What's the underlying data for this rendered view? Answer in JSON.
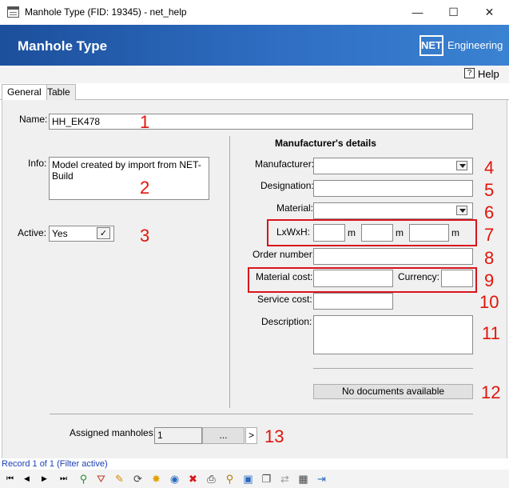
{
  "window": {
    "title": "Manhole Type (FID: 19345) - net_help",
    "minimize": "—",
    "maximize": "☐",
    "close": "✕"
  },
  "banner": {
    "title": "Manhole Type",
    "logo_box": "NET",
    "logo_text": "Engineering"
  },
  "help": {
    "label": "Help",
    "icon_glyph": "?"
  },
  "tabs": [
    {
      "label": "General"
    },
    {
      "label": "Table"
    }
  ],
  "form": {
    "name_label": "Name:",
    "name_value": "HH_EK478",
    "info_label": "Info:",
    "info_value": "Model created by import from NET-Build",
    "active_label": "Active:",
    "active_value": "Yes",
    "active_check": "✓",
    "manufacturer_section": "Manufacturer's details",
    "manufacturer_label": "Manufacturer:",
    "manufacturer_value": "",
    "designation_label": "Designation:",
    "designation_value": "",
    "material_label": "Material:",
    "material_value": "",
    "dims_label": "LxWxH:",
    "dims_unit": "m",
    "dims_l": "",
    "dims_w": "",
    "dims_h": "",
    "order_label": "Order number:",
    "order_value": "",
    "material_cost_label": "Material cost:",
    "material_cost_value": "",
    "currency_label": "Currency:",
    "currency_value": "",
    "service_cost_label": "Service cost:",
    "service_cost_value": "",
    "description_label": "Description:",
    "description_value": "",
    "documents_button": "No documents available",
    "assigned_label": "Assigned manholes:",
    "assigned_value": "1",
    "assigned_more": "...",
    "assigned_next": ">"
  },
  "annotations": [
    "1",
    "2",
    "3",
    "4",
    "5",
    "6",
    "7",
    "8",
    "9",
    "10",
    "11",
    "12",
    "13"
  ],
  "status": {
    "record": "Record 1 of 1 (Filter active)"
  },
  "toolbar": {
    "first": "⏮",
    "prev": "◀",
    "next": "▶",
    "last": "⏭",
    "filter_add": "⚲",
    "filter": "⛛",
    "edit": "✎",
    "refresh": "⟳",
    "new": "✸",
    "globe": "◉",
    "delete": "✖",
    "print": "⎙",
    "zoom": "⚲",
    "select": "▣",
    "copy": "❐",
    "move": "⇄",
    "table": "▦",
    "exit": "⇥"
  },
  "colors": {
    "annotation_red": "#e0150b",
    "banner_blue": "#2f6ec2",
    "status_blue": "#1a3fb5"
  }
}
